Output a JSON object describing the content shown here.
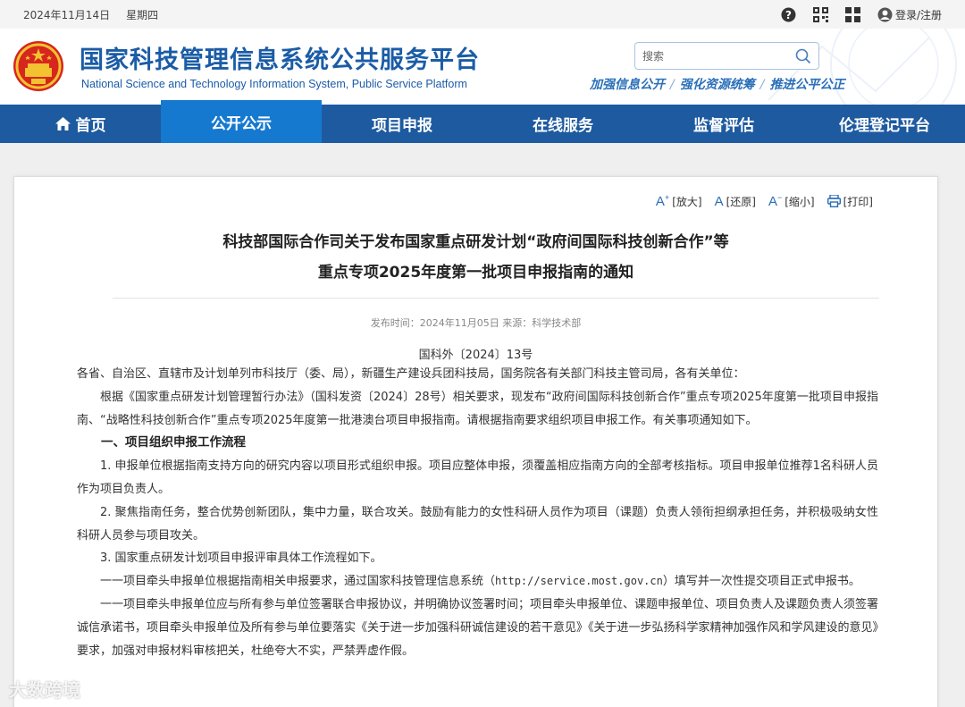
{
  "topbar": {
    "date": "2024年11月14日",
    "weekday": "星期四",
    "login_label": "登录/注册"
  },
  "header": {
    "title_cn": "国家科技管理信息系统公共服务平台",
    "title_en": "National Science and Technology Information System, Public Service Platform",
    "search_placeholder": "搜索",
    "slogan": [
      "加强信息公开",
      "强化资源统筹",
      "推进公平公正"
    ]
  },
  "nav": {
    "items": [
      {
        "label": "首页"
      },
      {
        "label": "公开公示"
      },
      {
        "label": "项目申报"
      },
      {
        "label": "在线服务"
      },
      {
        "label": "监督评估"
      },
      {
        "label": "伦理登记平台"
      }
    ],
    "active_index": 1
  },
  "tools": {
    "enlarge": "[放大]",
    "reset": "[还原]",
    "shrink": "[缩小]",
    "print": "[打印]"
  },
  "article": {
    "title_line1": "科技部国际合作司关于发布国家重点研发计划“政府间国际科技创新合作”等",
    "title_line2": "重点专项2025年度第一批项目申报指南的通知",
    "meta": "发布时间：2024年11月05日 来源：科学技术部",
    "doc_number": "国科外〔2024〕13号",
    "recipients": "各省、自治区、直辖市及计划单列市科技厅（委、局），新疆生产建设兵团科技局，国务院各有关部门科技主管司局，各有关单位：",
    "para1": "根据《国家重点研发计划管理暂行办法》（国科发资〔2024〕28号）相关要求，现发布“政府间国际科技创新合作”重点专项2025年度第一批项目申报指南、“战略性科技创新合作”重点专项2025年度第一批港澳台项目申报指南。请根据指南要求组织项目申报工作。有关事项通知如下。",
    "heading1": "一、项目组织申报工作流程",
    "item1": "1. 申报单位根据指南支持方向的研究内容以项目形式组织申报。项目应整体申报，须覆盖相应指南方向的全部考核指标。项目申报单位推荐1名科研人员作为项目负责人。",
    "item2": "2. 聚焦指南任务，整合优势创新团队，集中力量，联合攻关。鼓励有能力的女性科研人员作为项目（课题）负责人领衔担纲承担任务，并积极吸纳女性科研人员参与项目攻关。",
    "item3": "3. 国家重点研发计划项目申报评审具体工作流程如下。",
    "step1_pre": "一一项目牵头申报单位根据指南相关申报要求，通过国家科技管理信息系统（",
    "step1_url": "http://service.most.gov.cn",
    "step1_post": "）填写并一次性提交项目正式申报书。",
    "step2": "一一项目牵头申报单位应与所有参与单位签署联合申报协议，并明确协议签署时间；项目牵头申报单位、课题申报单位、项目负责人及课题负责人须签署诚信承诺书，项目牵头申报单位及所有参与单位要落实《关于进一步加强科研诚信建设的若干意见》《关于进一步弘扬科学家精神加强作风和学风建设的意见》要求，加强对申报材料审核把关，杜绝夸大不实，严禁弄虚作假。"
  },
  "watermark": "大数跨境",
  "colors": {
    "brand_blue": "#1e5aa0",
    "active_blue": "#1679d0",
    "title_blue": "#1b5ca6"
  }
}
